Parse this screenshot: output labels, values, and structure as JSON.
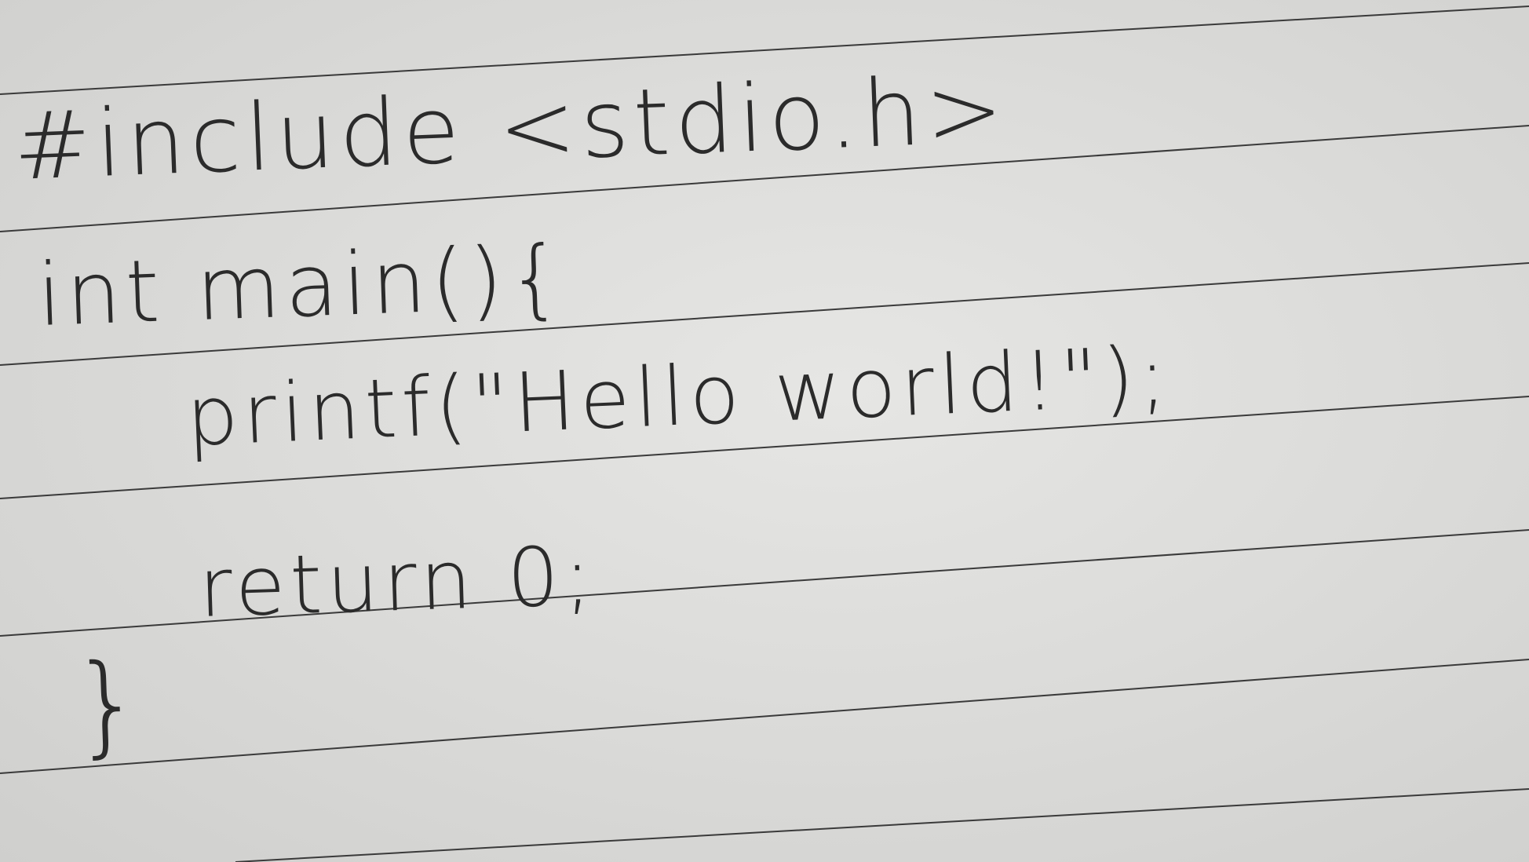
{
  "code_lines": [
    "#include <stdio.h>",
    "int main(){",
    "printf(\"Hello world!\");",
    "return 0;",
    "}"
  ],
  "colors": {
    "paper": "#dcdcda",
    "rule_line": "#3a3a3a",
    "ink": "#2b2b2b"
  }
}
